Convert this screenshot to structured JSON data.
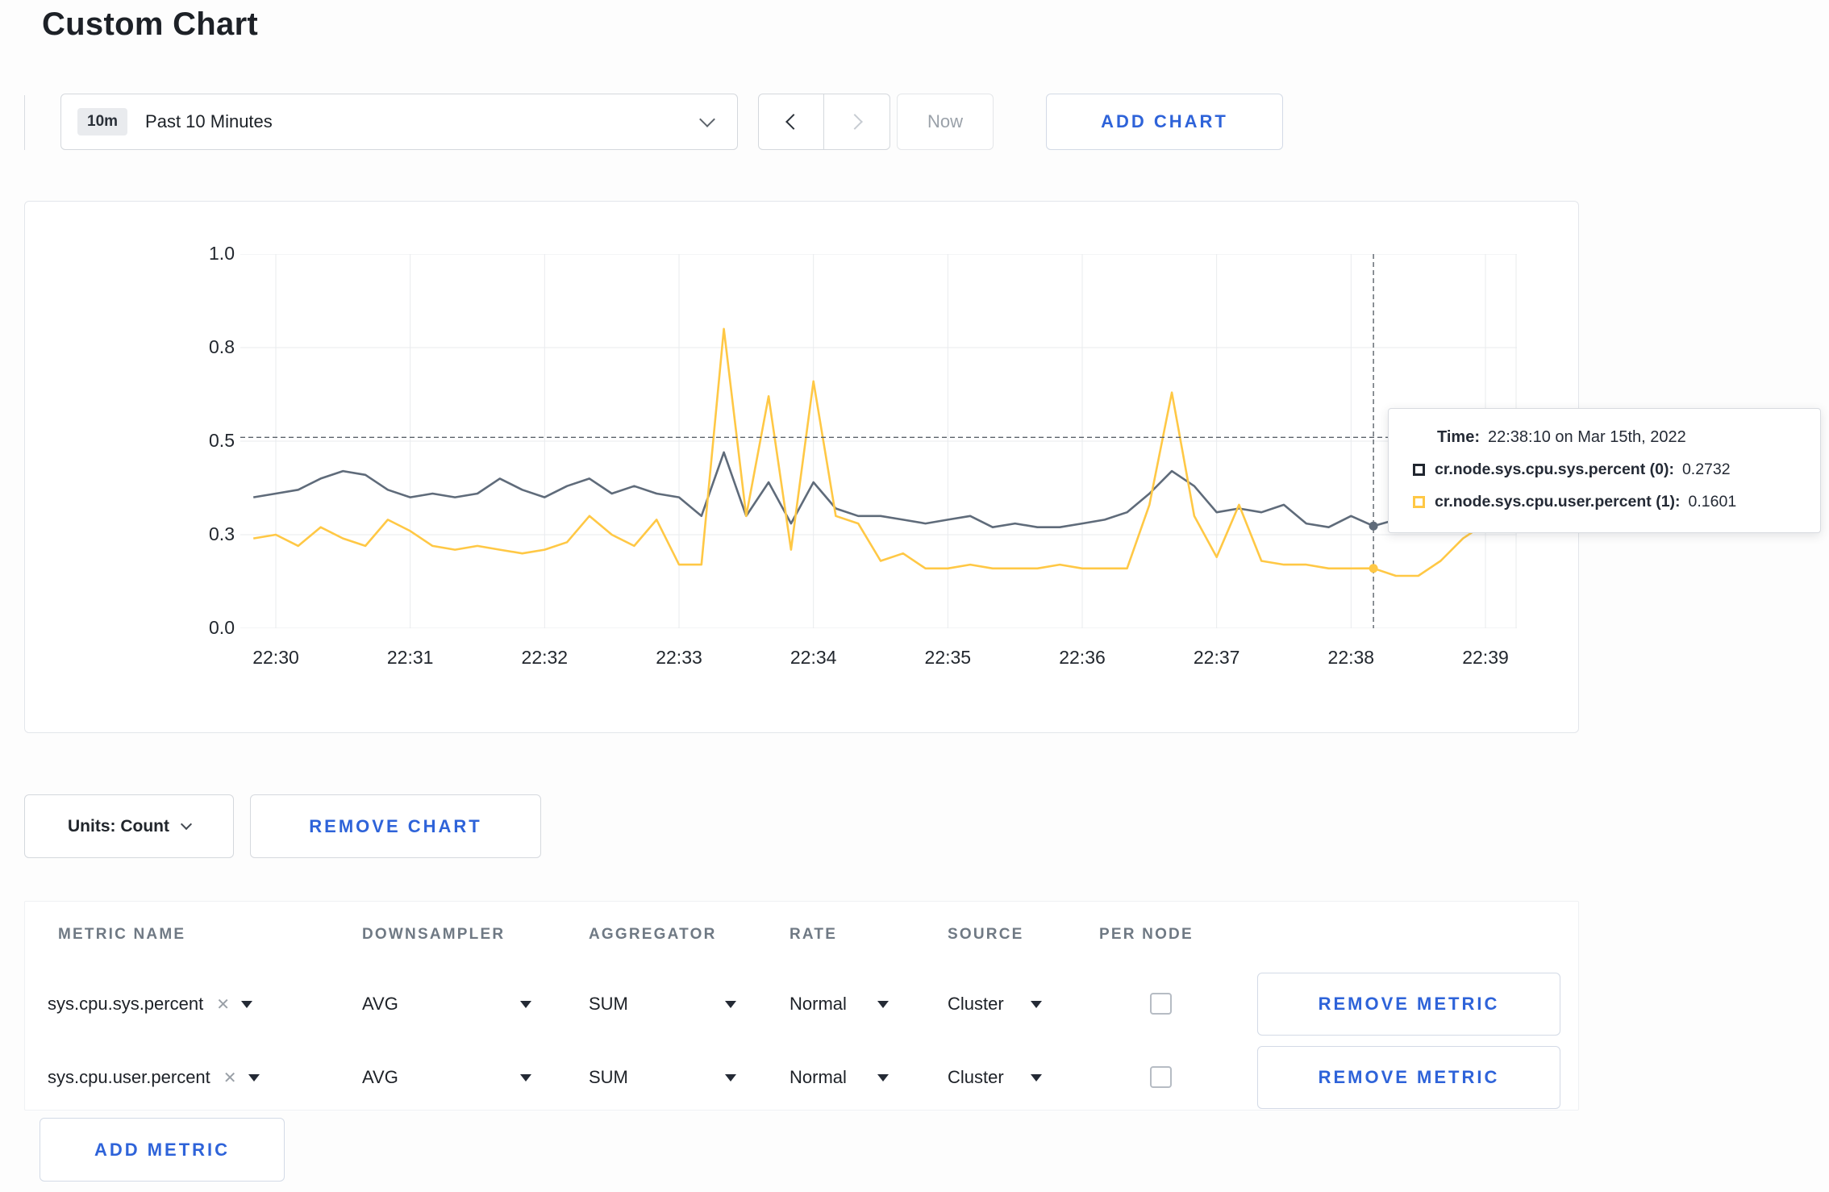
{
  "page": {
    "title": "Custom Chart"
  },
  "toolbar": {
    "range_badge": "10m",
    "range_label": "Past 10 Minutes",
    "now_label": "Now",
    "add_chart_label": "ADD CHART"
  },
  "icons": {
    "clear": "✕"
  },
  "tooltip": {
    "time_label": "Time:",
    "time_value": "22:38:10 on Mar 15th, 2022",
    "series": [
      {
        "label": "cr.node.sys.cpu.sys.percent (0):",
        "value": "0.2732",
        "color": "#20262f"
      },
      {
        "label": "cr.node.sys.cpu.user.percent (1):",
        "value": "0.1601",
        "color": "#ffc845"
      }
    ]
  },
  "chart_controls": {
    "units_label": "Units: Count",
    "remove_chart_label": "REMOVE CHART"
  },
  "metrics_table": {
    "headers": [
      "METRIC NAME",
      "DOWNSAMPLER",
      "AGGREGATOR",
      "RATE",
      "SOURCE",
      "PER NODE"
    ],
    "rows": [
      {
        "metric": "sys.cpu.sys.percent",
        "downsampler": "AVG",
        "aggregator": "SUM",
        "rate": "Normal",
        "source": "Cluster",
        "per_node_checked": false,
        "remove_label": "REMOVE METRIC"
      },
      {
        "metric": "sys.cpu.user.percent",
        "downsampler": "AVG",
        "aggregator": "SUM",
        "rate": "Normal",
        "source": "Cluster",
        "per_node_checked": false,
        "remove_label": "REMOVE METRIC"
      }
    ],
    "add_metric_label": "ADD METRIC"
  },
  "chart_data": {
    "type": "line",
    "title": "",
    "xlabel": "",
    "ylabel": "",
    "ylim": [
      0,
      1
    ],
    "grid": true,
    "legend": "none",
    "yticks": [
      {
        "value": 0,
        "label": "0.0"
      },
      {
        "value": 0.25,
        "label": "0.3"
      },
      {
        "value": 0.5,
        "label": "0.5"
      },
      {
        "value": 0.75,
        "label": "0.8"
      },
      {
        "value": 1,
        "label": "1.0"
      }
    ],
    "xticks": [
      "22:30",
      "22:31",
      "22:32",
      "22:33",
      "22:34",
      "22:35",
      "22:36",
      "22:37",
      "22:38",
      "22:39"
    ],
    "x": [
      "22:29:50",
      "22:30:00",
      "22:30:10",
      "22:30:20",
      "22:30:30",
      "22:30:40",
      "22:30:50",
      "22:31:00",
      "22:31:10",
      "22:31:20",
      "22:31:30",
      "22:31:40",
      "22:31:50",
      "22:32:00",
      "22:32:10",
      "22:32:20",
      "22:32:30",
      "22:32:40",
      "22:32:50",
      "22:33:00",
      "22:33:10",
      "22:33:20",
      "22:33:30",
      "22:33:40",
      "22:33:50",
      "22:34:00",
      "22:34:10",
      "22:34:20",
      "22:34:30",
      "22:34:40",
      "22:34:50",
      "22:35:00",
      "22:35:10",
      "22:35:20",
      "22:35:30",
      "22:35:40",
      "22:35:50",
      "22:36:00",
      "22:36:10",
      "22:36:20",
      "22:36:30",
      "22:36:40",
      "22:36:50",
      "22:37:00",
      "22:37:10",
      "22:37:20",
      "22:37:30",
      "22:37:40",
      "22:37:50",
      "22:38:00",
      "22:38:10",
      "22:38:20",
      "22:38:30",
      "22:38:40",
      "22:38:50",
      "22:39:00"
    ],
    "series": [
      {
        "name": "cr.node.sys.cpu.sys.percent",
        "color": "#5f6b7a",
        "values": [
          0.35,
          0.36,
          0.37,
          0.4,
          0.42,
          0.41,
          0.37,
          0.35,
          0.36,
          0.35,
          0.36,
          0.4,
          0.37,
          0.35,
          0.38,
          0.4,
          0.36,
          0.38,
          0.36,
          0.35,
          0.3,
          0.47,
          0.3,
          0.39,
          0.28,
          0.39,
          0.32,
          0.3,
          0.3,
          0.29,
          0.28,
          0.29,
          0.3,
          0.27,
          0.28,
          0.27,
          0.27,
          0.28,
          0.29,
          0.31,
          0.36,
          0.42,
          0.38,
          0.31,
          0.32,
          0.31,
          0.33,
          0.28,
          0.27,
          0.3,
          0.2732,
          0.29,
          0.27,
          0.28,
          0.31,
          0.3
        ]
      },
      {
        "name": "cr.node.sys.cpu.user.percent",
        "color": "#ffc845",
        "values": [
          0.24,
          0.25,
          0.22,
          0.27,
          0.24,
          0.22,
          0.29,
          0.26,
          0.22,
          0.21,
          0.22,
          0.21,
          0.2,
          0.21,
          0.23,
          0.3,
          0.25,
          0.22,
          0.29,
          0.17,
          0.17,
          0.8,
          0.3,
          0.62,
          0.21,
          0.66,
          0.3,
          0.28,
          0.18,
          0.2,
          0.16,
          0.16,
          0.17,
          0.16,
          0.16,
          0.16,
          0.17,
          0.16,
          0.16,
          0.16,
          0.33,
          0.63,
          0.3,
          0.19,
          0.33,
          0.18,
          0.17,
          0.17,
          0.16,
          0.16,
          0.1601,
          0.14,
          0.14,
          0.18,
          0.24,
          0.28
        ]
      }
    ],
    "crosshair": {
      "time": "22:38:10",
      "hover_value": 0.51
    }
  }
}
